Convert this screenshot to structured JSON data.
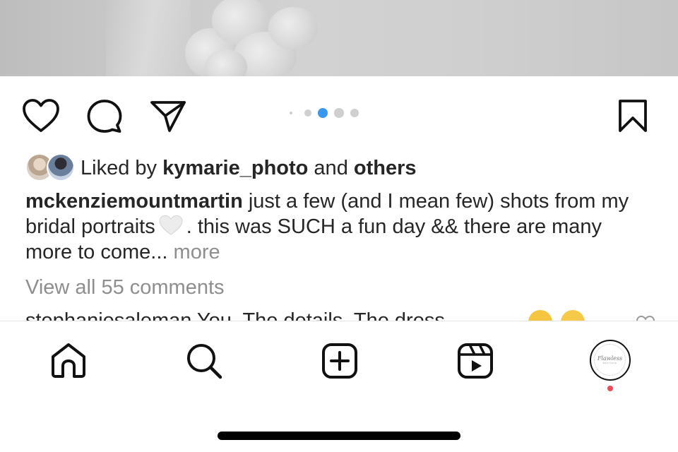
{
  "post": {
    "image_alt": "",
    "carousel": {
      "total": 5,
      "active_index": 2
    }
  },
  "actions": {
    "like_icon": "heart-icon",
    "comment_icon": "comment-bubble-icon",
    "share_icon": "paper-plane-icon",
    "save_icon": "bookmark-icon"
  },
  "likes": {
    "prefix": "Liked by ",
    "user": "kymarie_photo",
    "joiner": " and ",
    "others": "others"
  },
  "caption": {
    "username": "mckenziemountmartin",
    "text_before_emoji": " just a few (and I mean few) shots from my bridal portraits",
    "emoji": "white-heart-emoji",
    "text_after_emoji": ". this was SUCH a fun day && there are many more to come...",
    "more": "more"
  },
  "comments": {
    "view_all": "View all 55 comments",
    "preview_text": "stephaniesaleman  You. The details. The dress."
  },
  "tabbar": {
    "items": [
      {
        "name": "home",
        "icon": "home-icon"
      },
      {
        "name": "search",
        "icon": "search-icon"
      },
      {
        "name": "create",
        "icon": "plus-square-icon"
      },
      {
        "name": "reels",
        "icon": "reels-icon"
      },
      {
        "name": "profile",
        "icon": "profile-avatar"
      }
    ],
    "profile_logo_text": "Flawless",
    "profile_logo_sub": "BOUTIQUE",
    "has_notification": true
  },
  "colors": {
    "active_dot": "#3897f0",
    "inactive_dot": "#cfcfcf",
    "notification": "#ed4956",
    "secondary_text": "#8e8e8e"
  }
}
